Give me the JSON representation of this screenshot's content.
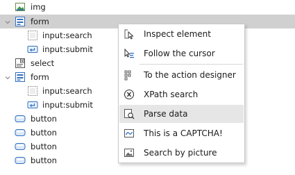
{
  "tree": [
    {
      "label": "img",
      "icon": "image-element-icon",
      "indent": 0,
      "chevron": false
    },
    {
      "label": "form",
      "icon": "form-element-icon",
      "indent": 0,
      "chevron": true,
      "selected": true
    },
    {
      "label": "input:search",
      "icon": "input-search-icon",
      "indent": 1,
      "chevron": false
    },
    {
      "label": "input:submit",
      "icon": "input-submit-icon",
      "indent": 1,
      "chevron": false
    },
    {
      "label": "select",
      "icon": "select-element-icon",
      "indent": 0,
      "chevron": false
    },
    {
      "label": "form",
      "icon": "form-element-icon",
      "indent": 0,
      "chevron": true
    },
    {
      "label": "input:search",
      "icon": "input-search-icon",
      "indent": 1,
      "chevron": false
    },
    {
      "label": "input:submit",
      "icon": "input-submit-icon",
      "indent": 1,
      "chevron": false
    },
    {
      "label": "button",
      "icon": "button-element-icon",
      "indent": 0,
      "chevron": false
    },
    {
      "label": "button",
      "icon": "button-element-icon",
      "indent": 0,
      "chevron": false
    },
    {
      "label": "button",
      "icon": "button-element-icon",
      "indent": 0,
      "chevron": false
    },
    {
      "label": "button",
      "icon": "button-element-icon",
      "indent": 0,
      "chevron": false
    }
  ],
  "context_menu": {
    "items": [
      {
        "label": "Inspect element",
        "icon": "inspect-cursor-icon"
      },
      {
        "label": "Follow the cursor",
        "icon": "follow-cursor-icon"
      },
      {
        "label": "To the action designer",
        "icon": "action-designer-icon"
      },
      {
        "label": "XPath search",
        "icon": "xpath-icon"
      },
      {
        "label": "Parse data",
        "icon": "parse-data-icon",
        "highlighted": true
      },
      {
        "label": "This is a CAPTCHA!",
        "icon": "captcha-icon"
      },
      {
        "label": "Search by picture",
        "icon": "picture-search-icon"
      }
    ]
  },
  "colors": {
    "selected_row": "#d0d0d0",
    "menu_hover": "#e6e6e6",
    "icon_blue": "#2f6fc0",
    "icon_green": "#3a9a3a"
  }
}
